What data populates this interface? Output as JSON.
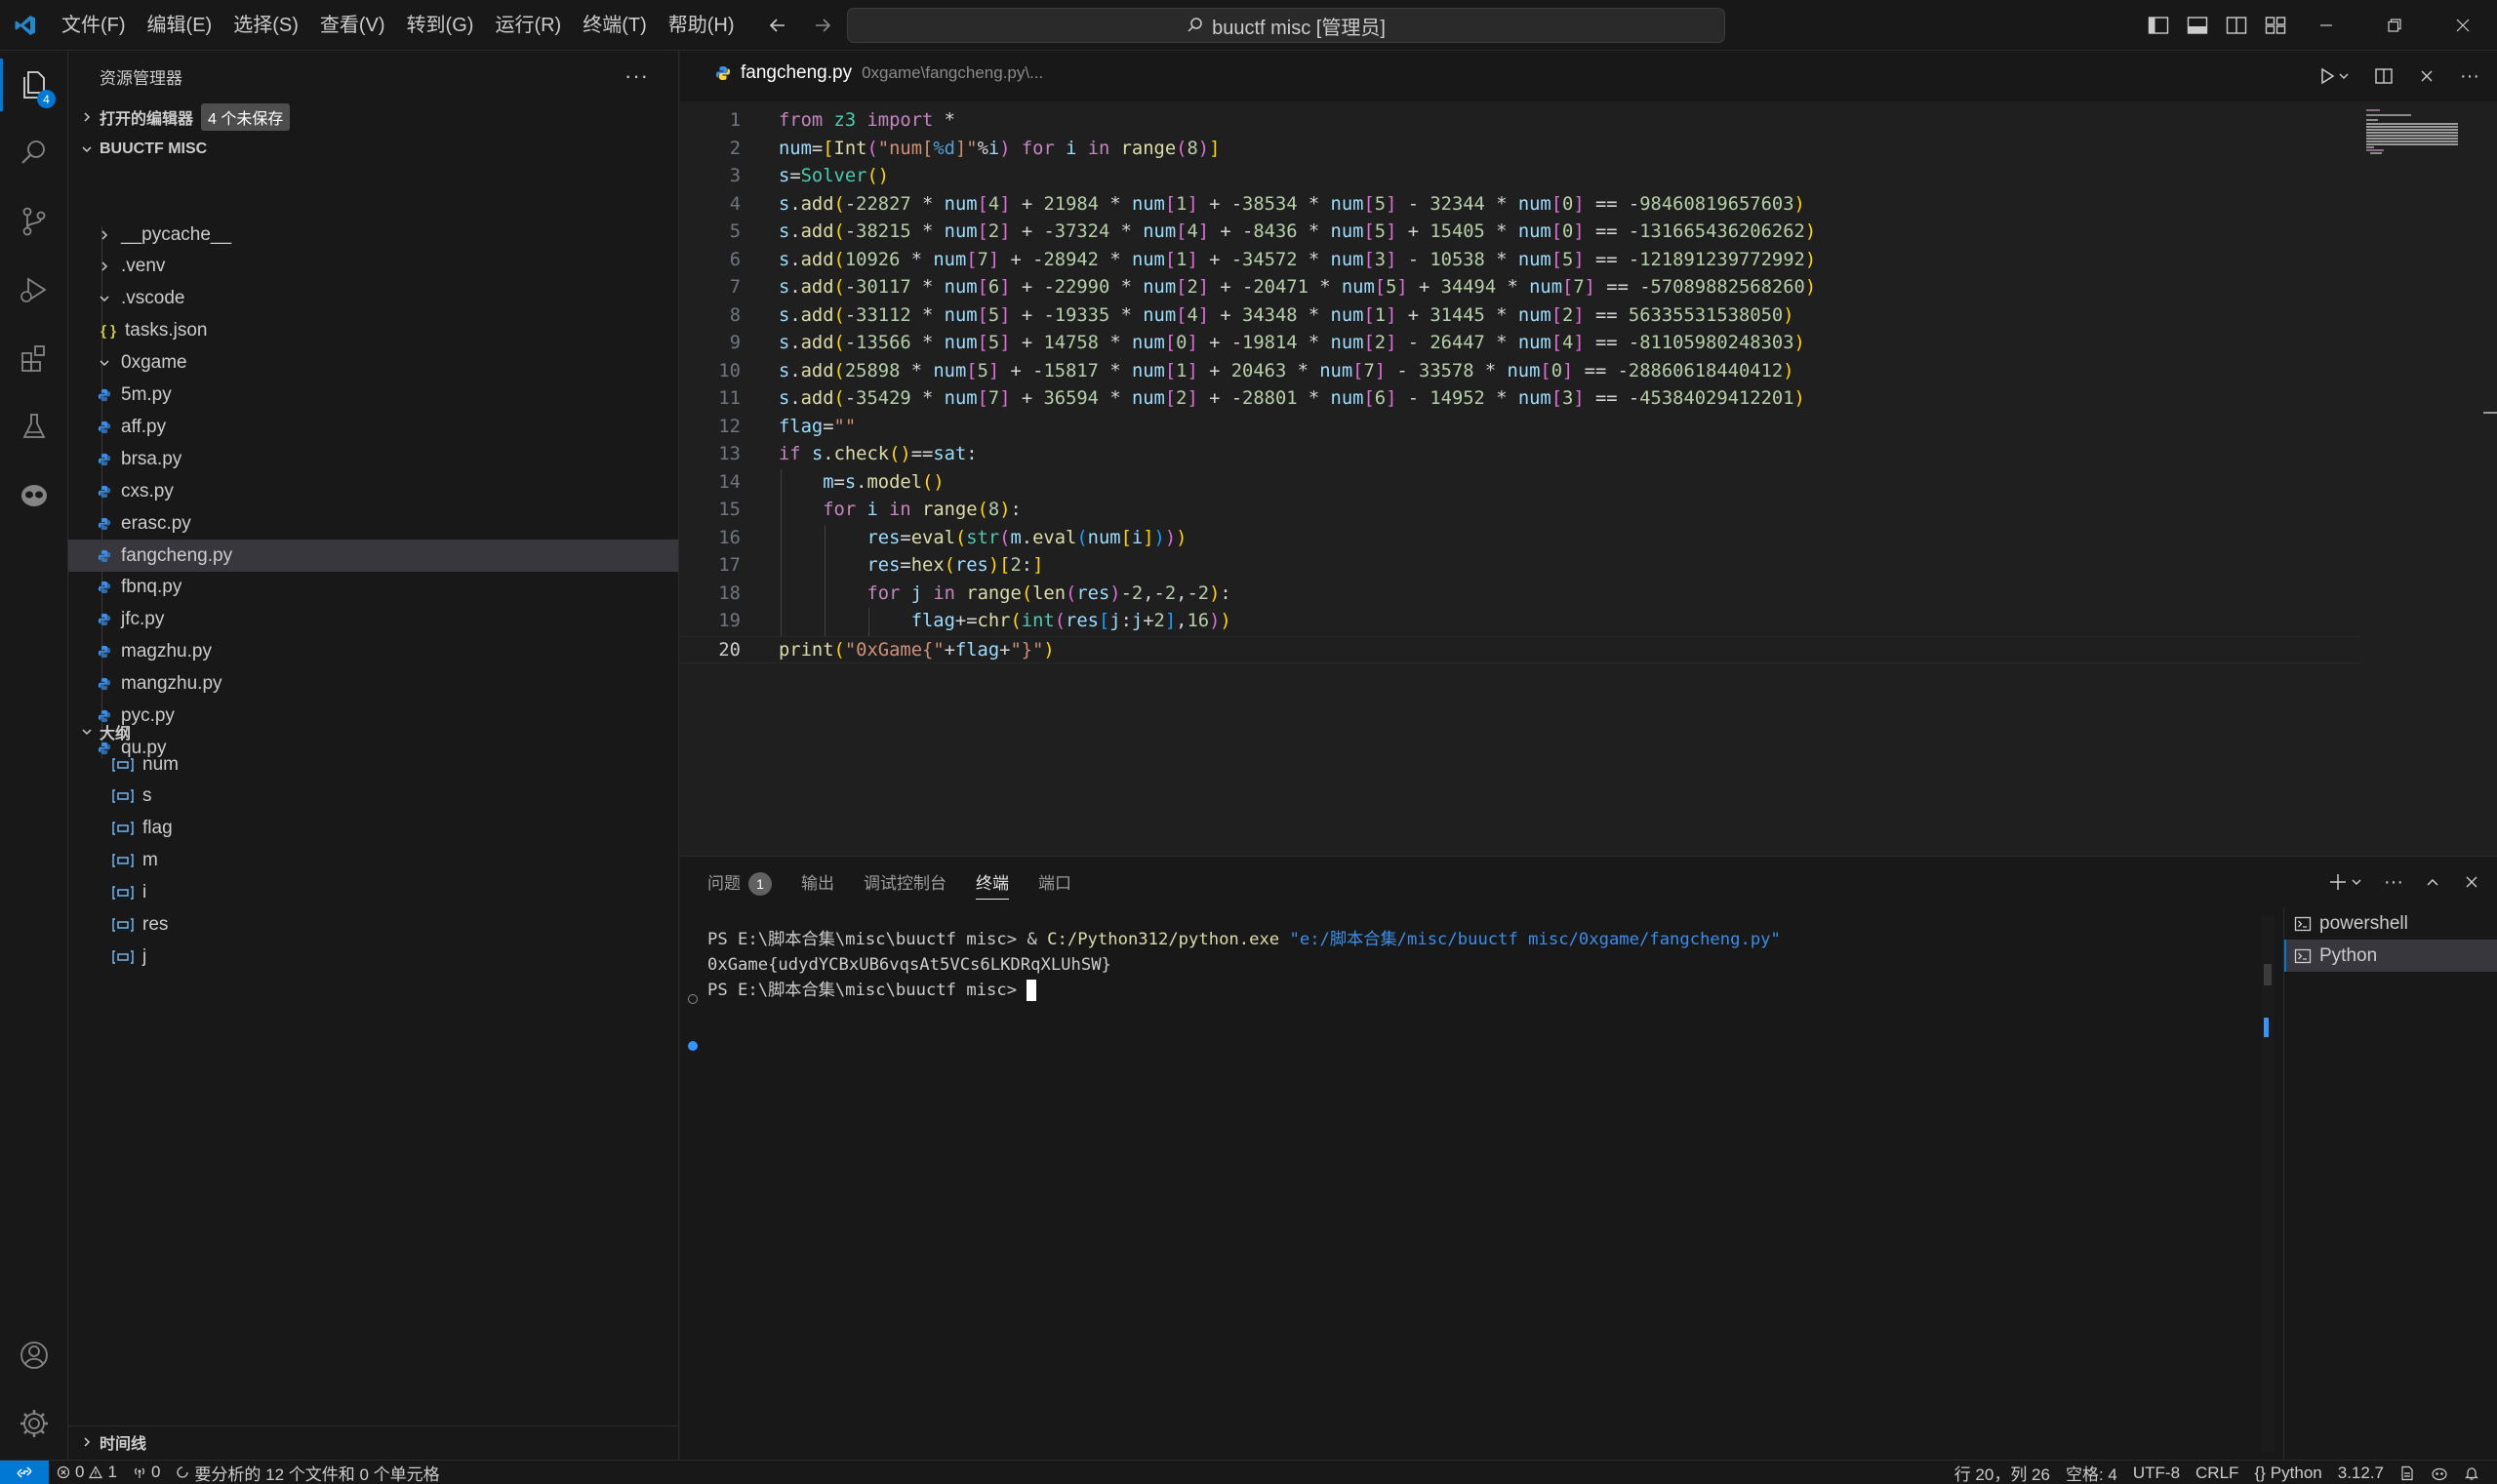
{
  "window": {
    "search_text": "buuctf misc [管理员]",
    "menu": [
      "文件(F)",
      "编辑(E)",
      "选择(S)",
      "查看(V)",
      "转到(G)",
      "运行(R)",
      "终端(T)",
      "帮助(H)"
    ]
  },
  "activity_bar": {
    "explorer_badge": "4"
  },
  "sidebar": {
    "title": "资源管理器",
    "open_editors_label": "打开的编辑器",
    "unsaved_badge": "4 个未保存",
    "folder_label": "BUUCTF MISC",
    "tree": [
      {
        "label": "__pycache__",
        "kind": "folder-collapsed"
      },
      {
        "label": ".venv",
        "kind": "folder-collapsed"
      },
      {
        "label": ".vscode",
        "kind": "folder-open"
      },
      {
        "label": "tasks.json",
        "kind": "json-file"
      },
      {
        "label": "0xgame",
        "kind": "folder-open"
      },
      {
        "label": "5m.py",
        "kind": "py-file"
      },
      {
        "label": "aff.py",
        "kind": "py-file"
      },
      {
        "label": "brsa.py",
        "kind": "py-file"
      },
      {
        "label": "cxs.py",
        "kind": "py-file"
      },
      {
        "label": "erasc.py",
        "kind": "py-file"
      },
      {
        "label": "fangcheng.py",
        "kind": "py-file",
        "selected": true
      },
      {
        "label": "fbnq.py",
        "kind": "py-file"
      },
      {
        "label": "jfc.py",
        "kind": "py-file"
      },
      {
        "label": "magzhu.py",
        "kind": "py-file"
      },
      {
        "label": "mangzhu.py",
        "kind": "py-file"
      },
      {
        "label": "pyc.py",
        "kind": "py-file"
      },
      {
        "label": "qu.py",
        "kind": "py-file"
      }
    ],
    "outline_label": "大纲",
    "outline": [
      "num",
      "s",
      "flag",
      "m",
      "i",
      "res",
      "j"
    ],
    "timeline_label": "时间线"
  },
  "editor": {
    "tab_file": "fangcheng.py",
    "tab_path": "0xgame\\fangcheng.py\\...",
    "current_line": 20,
    "lines": [
      "from z3 import *",
      "num=[Int(\"num[%d]\"%i) for i in range(8)]",
      "s=Solver()",
      "s.add(-22827 * num[4] + 21984 * num[1] + -38534 * num[5] - 32344 * num[0] == -98460819657603)",
      "s.add(-38215 * num[2] + -37324 * num[4] + -8436 * num[5] + 15405 * num[0] == -131665436206262)",
      "s.add(10926 * num[7] + -28942 * num[1] + -34572 * num[3] - 10538 * num[5] == -121891239772992)",
      "s.add(-30117 * num[6] + -22990 * num[2] + -20471 * num[5] + 34494 * num[7] == -57089882568260)",
      "s.add(-33112 * num[5] + -19335 * num[4] + 34348 * num[1] + 31445 * num[2] == 56335531538050)",
      "s.add(-13566 * num[5] + 14758 * num[0] + -19814 * num[2] - 26447 * num[4] == -81105980248303)",
      "s.add(25898 * num[5] + -15817 * num[1] + 20463 * num[7] - 33578 * num[0] == -28860618440412)",
      "s.add(-35429 * num[7] + 36594 * num[2] + -28801 * num[6] - 14952 * num[3] == -45384029412201)",
      "flag=\"\"",
      "if s.check()==sat:",
      "    m=s.model()",
      "    for i in range(8):",
      "        res=eval(str(m.eval(num[i])))",
      "        res=hex(res)[2:]",
      "        for j in range(len(res)-2,-2,-2):",
      "            flag+=chr(int(res[j:j+2],16))",
      "print(\"0xGame{\"+flag+\"}\")"
    ]
  },
  "panel": {
    "tabs": {
      "problems": "问题",
      "problems_count": "1",
      "output": "输出",
      "debug": "调试控制台",
      "terminal": "终端",
      "ports": "端口"
    },
    "terminal": {
      "prompt1": "PS E:\\脚本合集\\misc\\buuctf misc> ",
      "amp": "& ",
      "exe": "C:/Python312/python.exe",
      "arg": "\"e:/脚本合集/misc/buuctf misc/0xgame/fangcheng.py\"",
      "output": "0xGame{udydYCBxUB6vqsAt5VCs6LKDRqXLUhSW}",
      "prompt2": "PS E:\\脚本合集\\misc\\buuctf misc> "
    },
    "terminal_list": [
      "powershell",
      "Python"
    ]
  },
  "statusbar": {
    "errors": "0",
    "warnings": "1",
    "ports": "0",
    "analysis": "要分析的 12 个文件和 0 个单元格",
    "cursor_pos": "行 20，列 26",
    "indent": "空格: 4",
    "encoding": "UTF-8",
    "eol": "CRLF",
    "language": "Python",
    "python_version": "3.12.7"
  },
  "colors": {
    "accent": "#0078d4",
    "background": "#1f1f1f",
    "sidebar_bg": "#181818",
    "selection": "#37373d"
  }
}
